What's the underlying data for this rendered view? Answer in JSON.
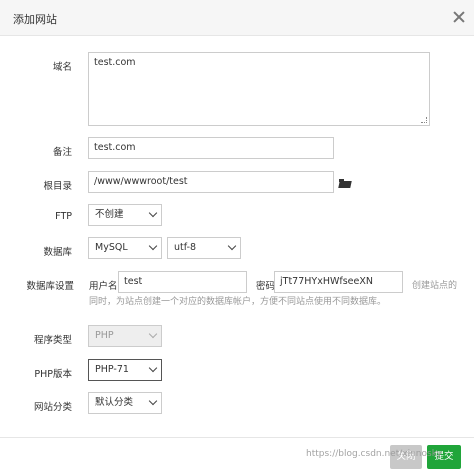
{
  "dialog": {
    "title": "添加网站"
  },
  "form": {
    "domain": {
      "label": "域名",
      "value": "test.com"
    },
    "remark": {
      "label": "备注",
      "value": "test.com"
    },
    "root": {
      "label": "根目录",
      "value": "/www/wwwroot/test"
    },
    "ftp": {
      "label": "FTP",
      "selected": "不创建"
    },
    "database": {
      "label": "数据库",
      "type": "MySQL",
      "charset": "utf-8"
    },
    "db_settings": {
      "label": "数据库设置",
      "user_label": "用户名",
      "user_value": "test",
      "pass_label": "密码",
      "pass_value": "jTt77HYxHWfseeXN",
      "hint_right": "创建站点的",
      "hint_line2": "同时，为站点创建一个对应的数据库帐户，方便不同站点使用不同数据库。"
    },
    "program_type": {
      "label": "程序类型",
      "selected": "PHP"
    },
    "php_version": {
      "label": "PHP版本",
      "selected": "PHP-71"
    },
    "site_category": {
      "label": "网站分类",
      "selected": "默认分类"
    }
  },
  "footer": {
    "cancel_label": "关闭",
    "submit_label": "提交",
    "watermark": "https://blog.csdn.net/xinnosky"
  },
  "colors": {
    "submit": "#20a53a",
    "cancel": "#c8c8c8"
  },
  "icons": {
    "close": "close-icon",
    "folder": "folder-icon",
    "dropdown": "chevron-down-icon"
  }
}
